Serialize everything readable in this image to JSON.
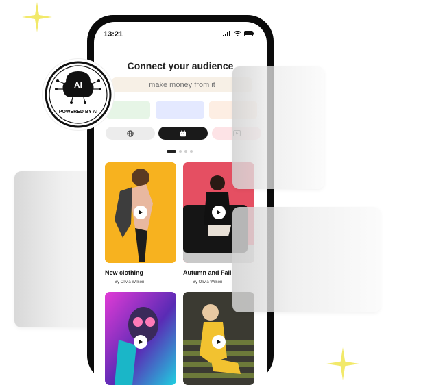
{
  "status": {
    "time": "13:21"
  },
  "header": {
    "title": "Connect your audience",
    "subtitle": "make money from it"
  },
  "colors": {
    "chip_green": "#e6f5e6",
    "chip_blue": "#e4e9ff",
    "chip_peach": "#fdeee3",
    "pill_gray": "#ececec",
    "pill_dark": "#1a1a1a",
    "pill_pink": "#fde3e6",
    "card1_bg": "#f7b21f",
    "card2_bg": "#e54f62"
  },
  "categories": [
    {
      "icon": "globe-icon"
    },
    {
      "icon": "calendar-icon"
    },
    {
      "icon": "video-icon"
    }
  ],
  "carousel": {
    "pages": 4,
    "active": 1
  },
  "cards": [
    {
      "title": "New clothing",
      "author": "By Olivia Wilson"
    },
    {
      "title": "Autumn and Fall",
      "author": "By Olivia Wilson"
    },
    {
      "title": "",
      "author": ""
    },
    {
      "title": "",
      "author": ""
    }
  ],
  "badge": {
    "label": "AI",
    "caption": "POWERED BY AI"
  }
}
